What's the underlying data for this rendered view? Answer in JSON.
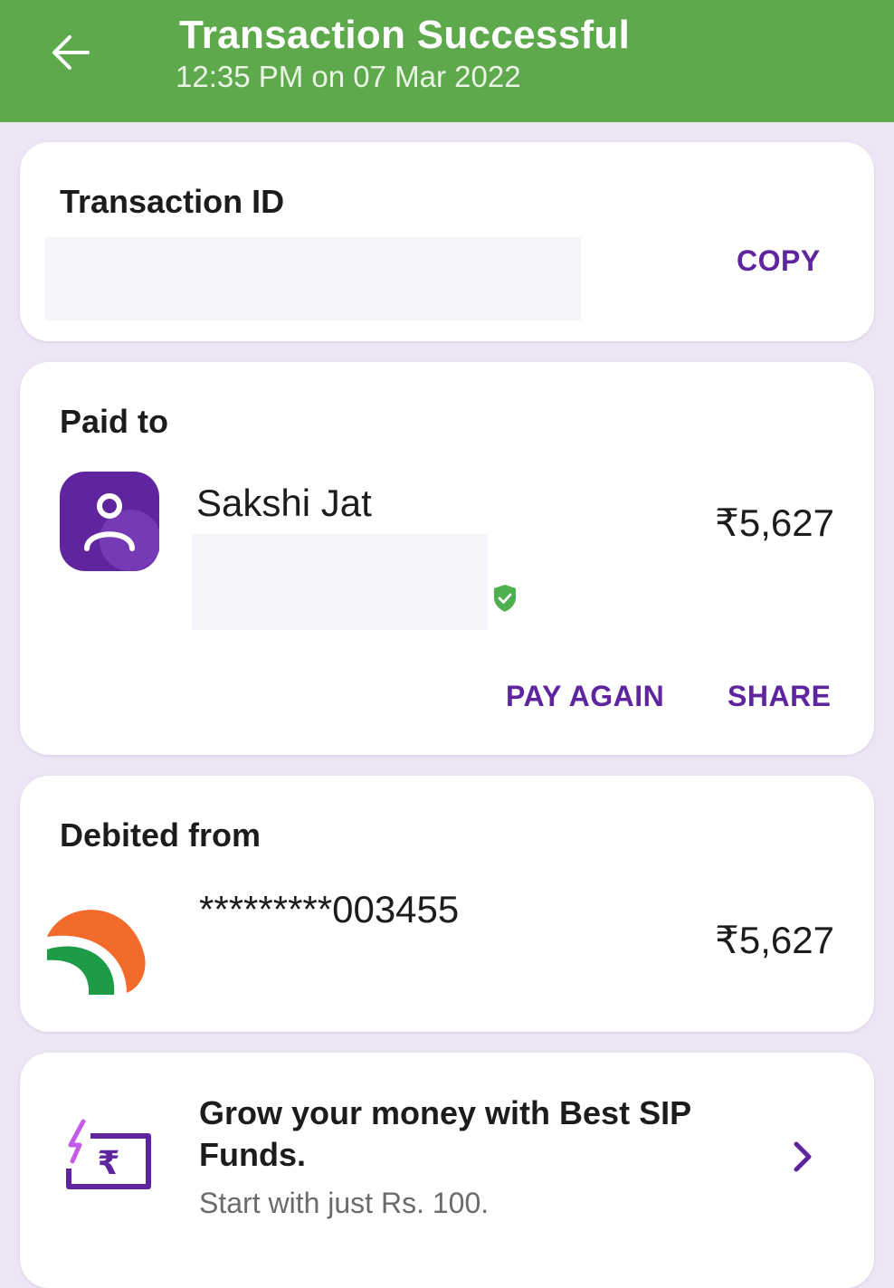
{
  "header": {
    "title": "Transaction Successful",
    "subtitle": "12:35 PM on 07 Mar 2022",
    "back_icon": "arrow-left-icon"
  },
  "transaction_card": {
    "title": "Transaction ID",
    "copy_label": "COPY"
  },
  "paid_to_card": {
    "title": "Paid to",
    "name": "Sakshi Jat",
    "amount": "₹5,627",
    "avatar_icon": "person-icon",
    "verified_icon": "verified-shield-icon",
    "pay_again_label": "PAY AGAIN",
    "share_label": "SHARE"
  },
  "debited_card": {
    "title": "Debited from",
    "account": "*********003455",
    "amount": "₹5,627",
    "bank_icon": "bank-logo-icon"
  },
  "promo_card": {
    "title": "Grow your money with Best SIP Funds.",
    "subtitle": "Start with just Rs. 100.",
    "icon": "rupee-lightning-icon",
    "chevron_icon": "chevron-right-icon"
  },
  "colors": {
    "header_green": "#5ea94c",
    "accent_purple": "#5f259f",
    "background": "#ece5f6"
  }
}
